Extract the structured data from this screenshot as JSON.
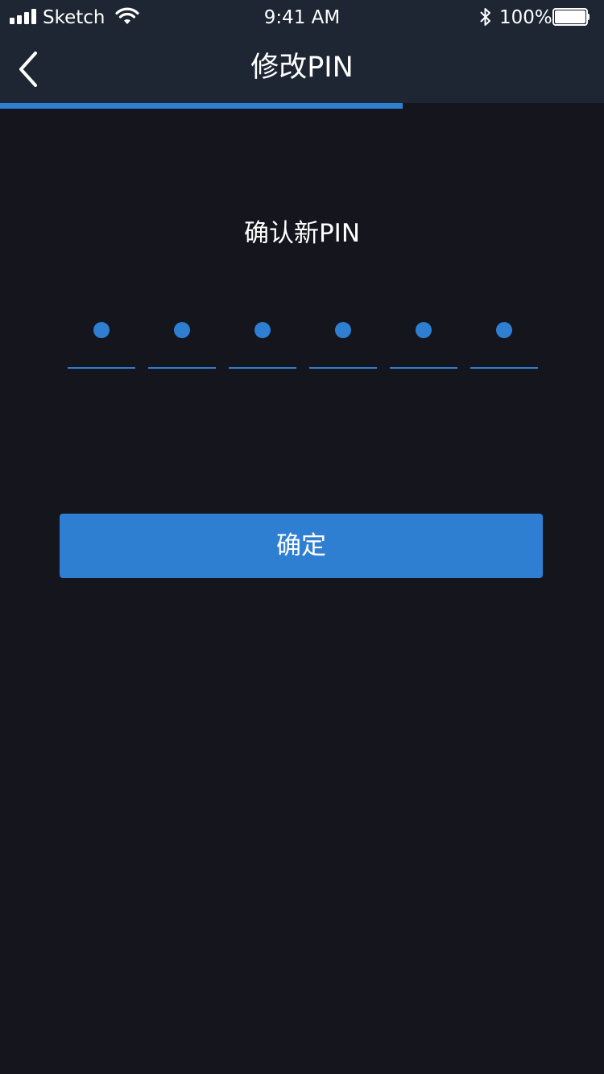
{
  "status_bar": {
    "carrier": "Sketch",
    "time": "9:41 AM",
    "battery_percent": "100%"
  },
  "nav": {
    "title": "修改PIN",
    "back_icon": "chevron-left-icon"
  },
  "progress": {
    "value": 0.667
  },
  "form": {
    "prompt": "确认新PIN",
    "pin_length": 6,
    "filled_count": 6,
    "confirm_label": "确定"
  },
  "colors": {
    "background": "#14151d",
    "header": "#1e2633",
    "accent": "#2e7fd2",
    "text": "#ffffff"
  }
}
